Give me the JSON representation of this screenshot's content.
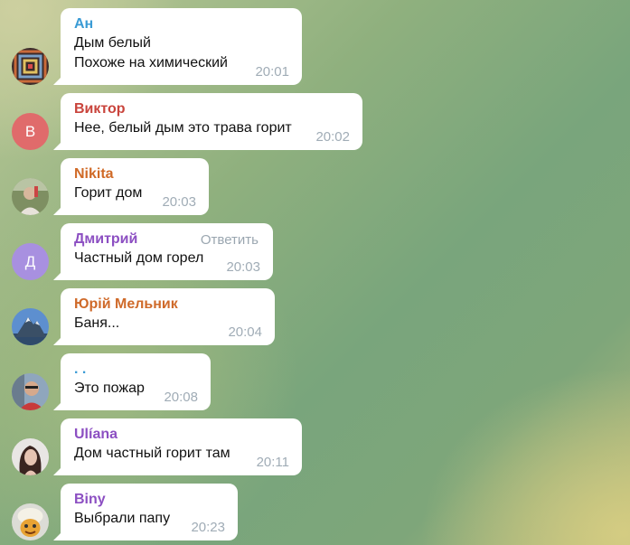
{
  "messages": [
    {
      "sender": "Ан",
      "sender_color": "#3a9bd5",
      "lines": [
        "Дым белый",
        "Похоже на химический"
      ],
      "time": "20:01",
      "avatar_icon": "patterned-avatar-icon"
    },
    {
      "sender": "Виктор",
      "sender_color": "#c9443c",
      "lines": [
        "Нее, белый дым это трава горит"
      ],
      "time": "20:02",
      "avatar_letter": "В",
      "avatar_color": "#e06b6b"
    },
    {
      "sender": "Nikita",
      "sender_color": "#d06a27",
      "lines": [
        "Горит дом"
      ],
      "time": "20:03",
      "avatar_icon": "photo-avatar-icon"
    },
    {
      "sender": "Дмитрий",
      "sender_color": "#8c4fc2",
      "lines": [
        "Частный дом горел"
      ],
      "time": "20:03",
      "reply_label": "Ответить",
      "avatar_letter": "Д",
      "avatar_color": "#a890e0"
    },
    {
      "sender": "Юрій Мельник",
      "sender_color": "#cf6a2a",
      "lines": [
        "Баня..."
      ],
      "time": "20:04",
      "avatar_icon": "mountain-avatar-icon"
    },
    {
      "sender": ". .",
      "sender_color": "#3a9bd5",
      "lines": [
        "Это пожар"
      ],
      "time": "20:08",
      "avatar_icon": "person-avatar-icon"
    },
    {
      "sender": "Ulíana",
      "sender_color": "#8c4fc2",
      "lines": [
        "Дом частный горит там"
      ],
      "time": "20:11",
      "avatar_icon": "person-avatar-icon"
    },
    {
      "sender": "Biny",
      "sender_color": "#8c4fc2",
      "lines": [
        "Выбрали папу"
      ],
      "time": "20:23",
      "avatar_icon": "character-avatar-icon"
    }
  ]
}
